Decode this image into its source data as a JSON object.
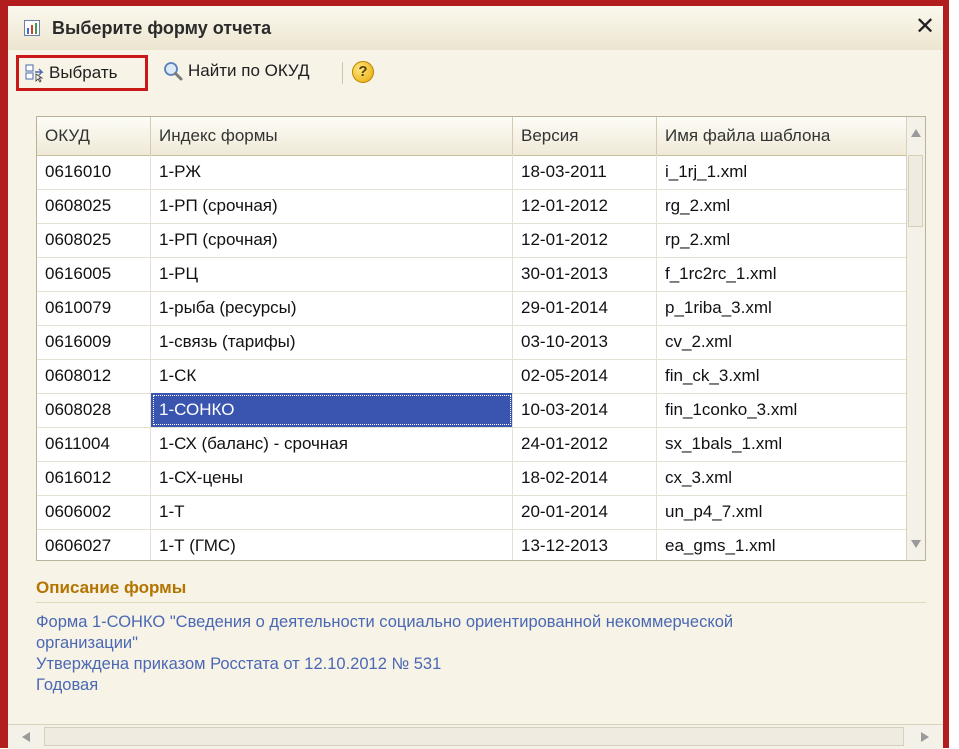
{
  "window": {
    "title": "Выберите форму отчета",
    "close_icon": "close-icon",
    "title_icon": "report-form-icon"
  },
  "toolbar": {
    "select_label": "Выбрать",
    "select_icon": "select-form-icon",
    "find_label": "Найти по ОКУД",
    "find_icon": "magnifier-icon",
    "help_label": "?",
    "help_icon": "help-icon"
  },
  "table": {
    "columns": [
      "ОКУД",
      "Индекс формы",
      "Версия",
      "Имя файла шаблона"
    ],
    "rows": [
      [
        "0616010",
        "1-РЖ",
        "18-03-2011",
        "i_1rj_1.xml"
      ],
      [
        "0608025",
        "1-РП (срочная)",
        "12-01-2012",
        "rg_2.xml"
      ],
      [
        "0608025",
        "1-РП (срочная)",
        "12-01-2012",
        "rp_2.xml"
      ],
      [
        "0616005",
        "1-РЦ",
        "30-01-2013",
        "f_1rc2rc_1.xml"
      ],
      [
        "0610079",
        "1-рыба (ресурсы)",
        "29-01-2014",
        "p_1riba_3.xml"
      ],
      [
        "0616009",
        "1-связь (тарифы)",
        "03-10-2013",
        "cv_2.xml"
      ],
      [
        "0608012",
        "1-СК",
        "02-05-2014",
        "fin_ck_3.xml"
      ],
      [
        "0608028",
        "1-СОНКО",
        "10-03-2014",
        "fin_1conko_3.xml"
      ],
      [
        "0611004",
        "1-СХ (баланс) - срочная",
        "24-01-2012",
        "sx_1bals_1.xml"
      ],
      [
        "0616012",
        "1-СХ-цены",
        "18-02-2014",
        "cx_3.xml"
      ],
      [
        "0606002",
        "1-Т",
        "20-01-2014",
        "un_p4_7.xml"
      ],
      [
        "0606027",
        "1-Т (ГМС)",
        "13-12-2013",
        "ea_gms_1.xml"
      ]
    ],
    "selected_row": 7,
    "selected_col": 1
  },
  "description": {
    "title": "Описание формы",
    "line1": "Форма 1-СОНКО \"Сведения о деятельности социально ориентированной некоммерческой",
    "line2": "организации\"",
    "line3": "Утверждена приказом Росстата от 12.10.2012 № 531",
    "line4": "Годовая"
  },
  "colors": {
    "frame_red": "#b21e1e",
    "selection_blue": "#3a55b0",
    "description_title": "#b37400",
    "description_text": "#4a68b4"
  }
}
